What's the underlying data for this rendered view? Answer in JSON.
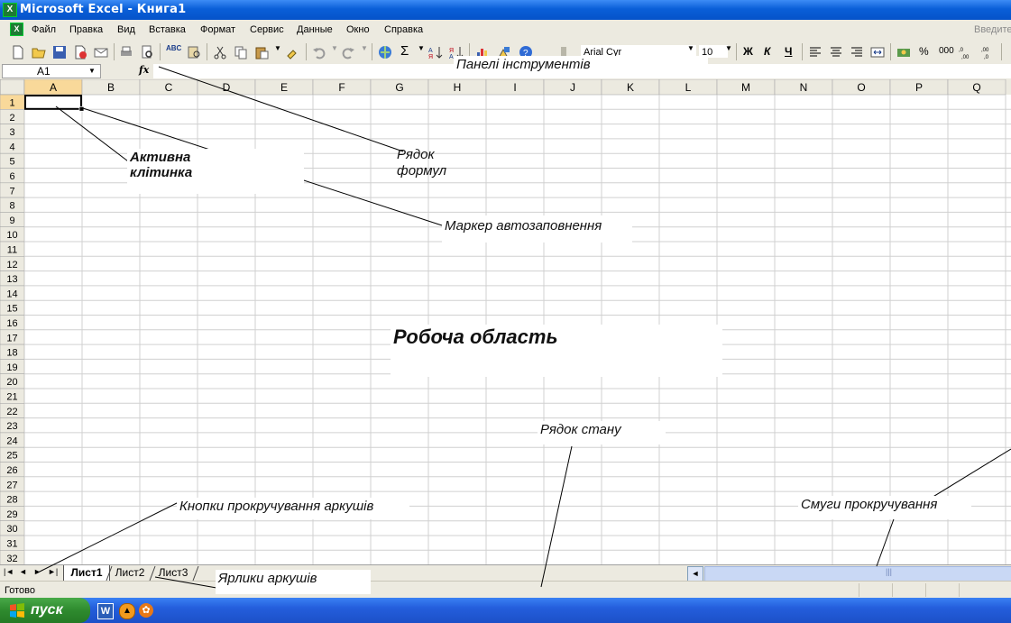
{
  "window": {
    "title": "Microsoft Excel - Книга1"
  },
  "menu": {
    "items": [
      "Файл",
      "Правка",
      "Вид",
      "Вставка",
      "Формат",
      "Сервис",
      "Данные",
      "Окно",
      "Справка"
    ],
    "help_placeholder": "Введите"
  },
  "toolbar": {
    "font_name": "Arial Cyr",
    "font_size": "10",
    "bold_label": "Ж",
    "italic_label": "К",
    "underline_label": "Ч",
    "percent_label": "%",
    "thousands_label": "000",
    "abc_label": "ABC"
  },
  "formula_bar": {
    "cell_ref": "A1",
    "fx_label": "fx",
    "formula": ""
  },
  "grid": {
    "columns": [
      "A",
      "B",
      "C",
      "D",
      "E",
      "F",
      "G",
      "H",
      "I",
      "J",
      "K",
      "L",
      "M",
      "N",
      "O",
      "P",
      "Q"
    ],
    "rows": [
      "1",
      "2",
      "3",
      "4",
      "5",
      "6",
      "7",
      "8",
      "9",
      "10",
      "11",
      "12",
      "13",
      "14",
      "15",
      "16",
      "17",
      "18",
      "19",
      "20",
      "21",
      "22",
      "23",
      "24",
      "25",
      "26",
      "27",
      "28",
      "29",
      "30",
      "31",
      "32"
    ],
    "active_cell": "A1"
  },
  "sheets": {
    "tabs": [
      "Лист1",
      "Лист2",
      "Лист3"
    ],
    "active": "Лист1"
  },
  "status": {
    "text": "Готово"
  },
  "taskbar": {
    "start_label": "пуск"
  },
  "annotations": {
    "toolbars": "Панелі інструментів",
    "formula_row_1": "Рядок",
    "formula_row_2": "формул",
    "active_cell_1": "Активна",
    "active_cell_2": "клітинка",
    "fill_handle": "Маркер автозаповнення",
    "work_area": "Робоча область",
    "status_row": "Рядок стану",
    "sheet_scroll_buttons": "Кнопки прокручування аркушів",
    "scrollbars": "Смуги прокручування",
    "sheet_tabs": "Ярлики аркушів"
  },
  "colors": {
    "title_bar": "#0a5fd8",
    "toolbar_bg": "#eceae0",
    "header_bg": "#eceae0",
    "active_header_bg": "#f9d99a",
    "gridline": "#d0d0d0",
    "start_button": "#2e8a2e",
    "taskbar": "#245edc"
  }
}
